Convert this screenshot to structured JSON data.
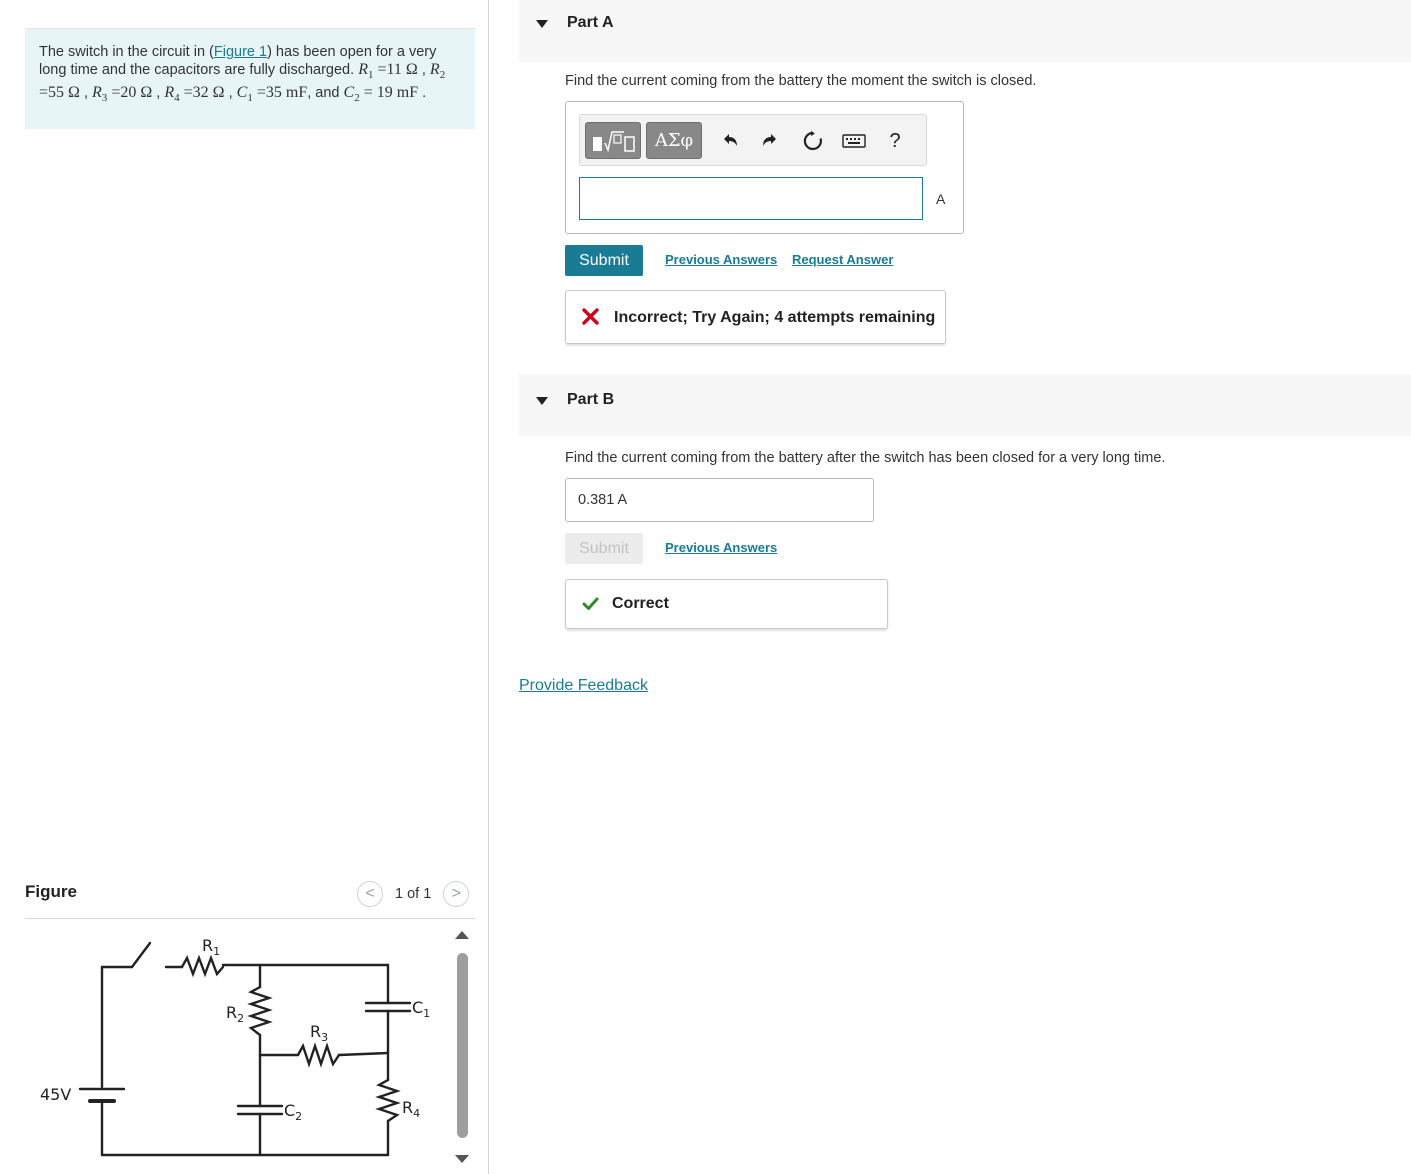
{
  "problem": {
    "text_1": "The switch in the circuit in (",
    "figure_link": "Figure 1",
    "text_2": ") has been open for a very long time and the capacitors are fully discharged.",
    "r1_value": "=11 Ω",
    "r2_value": "=55 Ω",
    "r3_value": "=20 Ω",
    "r4_value": "=32 Ω",
    "c1_value": "=35 mF",
    "c2_value": "=",
    "c2_number": "19 mF",
    "and_text": ", and"
  },
  "figure": {
    "title": "Figure",
    "pager_text": "1 of 1",
    "prev_symbol": "<",
    "next_symbol": ">",
    "labels": {
      "battery": "45V",
      "r1": "R1",
      "r2": "R2",
      "r3": "R3",
      "r4": "R4",
      "c1": "C1",
      "c2": "C2"
    }
  },
  "part_a": {
    "title": "Part A",
    "prompt": "Find the current coming from the battery the moment the switch is closed.",
    "toolbar": {
      "greek_label": "ΑΣφ",
      "help_label": "?"
    },
    "input_value": "",
    "unit": "A",
    "submit_label": "Submit",
    "previous_answers_label": "Previous Answers",
    "request_answer_label": "Request Answer",
    "feedback": "Incorrect; Try Again; 4 attempts remaining",
    "feedback_color": "#d0021b"
  },
  "part_b": {
    "title": "Part B",
    "prompt": "Find the current coming from the battery after the switch has been closed for a very long time.",
    "answer_value": "0.381  A",
    "submit_label": "Submit",
    "previous_answers_label": "Previous Answers",
    "feedback": "Correct",
    "feedback_color": "#2e8b2e"
  },
  "footer": {
    "provide_feedback_label": "Provide Feedback"
  }
}
